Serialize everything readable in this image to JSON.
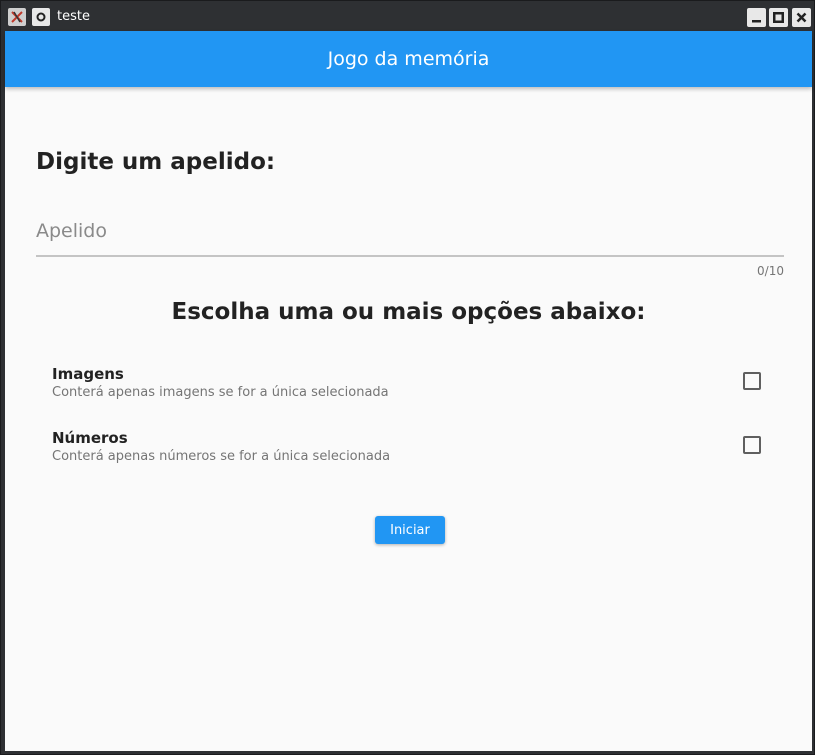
{
  "window": {
    "title": "teste",
    "app_icon": "x-app-icon",
    "menu_icon": "window-menu-icon",
    "controls": [
      "minimize-icon",
      "maximize-icon",
      "close-icon"
    ]
  },
  "appbar": {
    "title": "Jogo da memória",
    "color": "#2196f3"
  },
  "form": {
    "heading": "Digite um apelido:",
    "nickname": {
      "placeholder": "Apelido",
      "value": "",
      "counter": "0/10"
    },
    "options_heading": "Escolha uma ou mais opções abaixo:",
    "options": [
      {
        "title": "Imagens",
        "subtitle": "Conterá apenas imagens se for a única selecionada",
        "checked": false
      },
      {
        "title": "Números",
        "subtitle": "Conterá apenas números se for a única selecionada",
        "checked": false
      }
    ],
    "start_label": "Iniciar"
  }
}
